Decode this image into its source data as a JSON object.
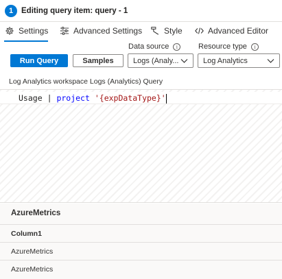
{
  "header": {
    "step": "1",
    "title": "Editing query item: query - 1"
  },
  "tabs": [
    {
      "label": "Settings",
      "icon": "gear-icon",
      "active": true
    },
    {
      "label": "Advanced Settings",
      "icon": "sliders-icon",
      "active": false
    },
    {
      "label": "Style",
      "icon": "brush-icon",
      "active": false
    },
    {
      "label": "Advanced Editor",
      "icon": "code-icon",
      "active": false
    }
  ],
  "toolbar": {
    "run_label": "Run Query",
    "samples_label": "Samples",
    "data_source_label": "Data source",
    "data_source_value": "Logs (Analy...",
    "resource_type_label": "Resource type",
    "resource_type_value": "Log Analytics"
  },
  "workspace_label": "Log Analytics workspace Logs (Analytics) Query",
  "editor": {
    "tokens": {
      "table": "Usage",
      "pipe": "|",
      "keyword": "project",
      "string": "'{expDataType}'"
    }
  },
  "results": {
    "title": "AzureMetrics",
    "column_header": "Column1",
    "rows": [
      "AzureMetrics",
      "AzureMetrics"
    ]
  },
  "colors": {
    "accent": "#0078d4",
    "keyword": "#0000ff",
    "string": "#a31515"
  }
}
